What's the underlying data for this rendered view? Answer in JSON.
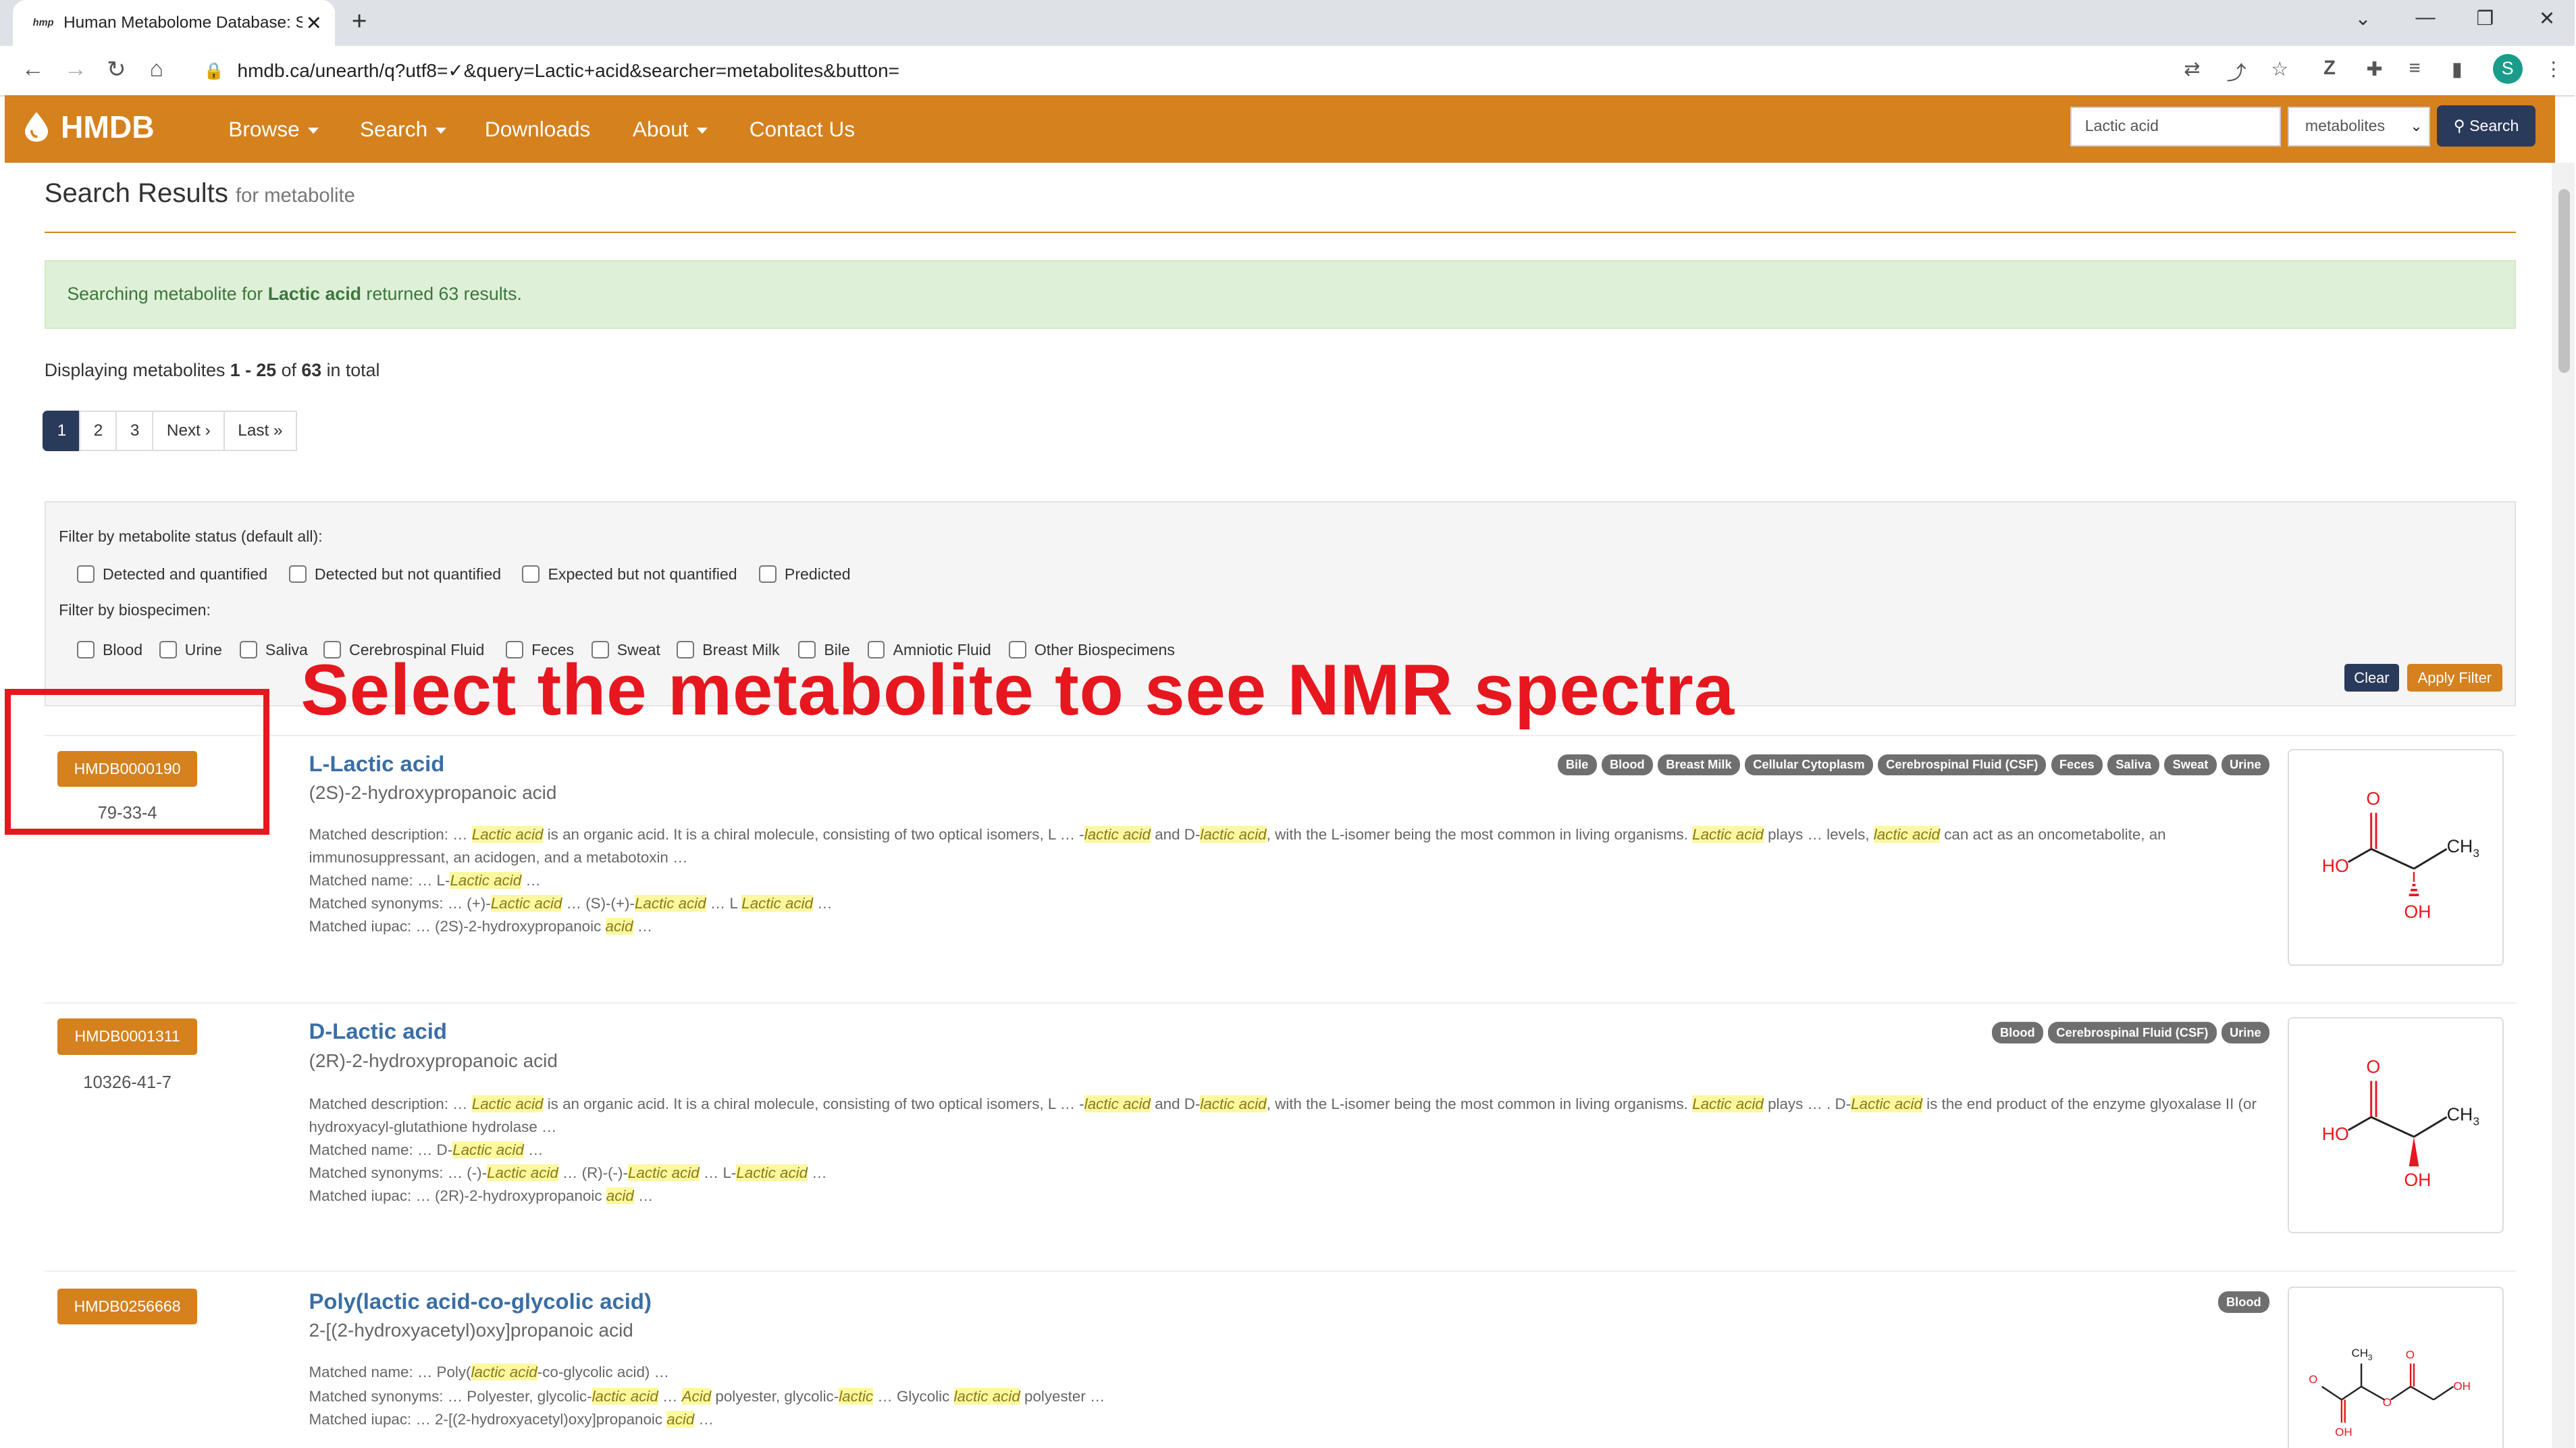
{
  "browser": {
    "tab_title": "Human Metabolome Database: S",
    "tab_favicon": "hmp",
    "url": "hmdb.ca/unearth/q?utf8=✓&query=Lactic+acid&searcher=metabolites&button=",
    "profile_initial": "S"
  },
  "navbar": {
    "logo": "HMDB",
    "menu": [
      "Browse",
      "Search",
      "Downloads",
      "About",
      "Contact Us"
    ],
    "search_value": "Lactic acid",
    "search_type": "metabolites",
    "search_button": "Search",
    "color": "#d4811e"
  },
  "page": {
    "title": "Search Results",
    "title_sub": "for metabolite",
    "alert_pre": "Searching metabolite for ",
    "alert_query": "Lactic acid",
    "alert_post": " returned 63 results.",
    "displaying_pre": "Displaying metabolites ",
    "displaying_range": "1 - 25",
    "displaying_of": " of ",
    "displaying_total": "63",
    "displaying_post": " in total",
    "pager": [
      "1",
      "2",
      "3",
      "Next ›",
      "Last »"
    ]
  },
  "filters": {
    "status_label": "Filter by metabolite status (default all):",
    "status": [
      "Detected and quantified",
      "Detected but not quantified",
      "Expected but not quantified",
      "Predicted"
    ],
    "biospecimen_label": "Filter by biospecimen:",
    "biospecimens": [
      "Blood",
      "Urine",
      "Saliva",
      "Cerebrospinal Fluid",
      "Feces",
      "Sweat",
      "Breast Milk",
      "Bile",
      "Amniotic Fluid",
      "Other Biospecimens"
    ],
    "clear": "Clear",
    "apply": "Apply Filter"
  },
  "annotation": {
    "text": "Select the metabolite to see  NMR spectra",
    "color": "#e6171e"
  },
  "results": [
    {
      "id": "HMDB0000190",
      "cas": "79-33-4",
      "name": "L-Lactic acid",
      "iupac": "(2S)-2-hydroxypropanoic acid",
      "tags": [
        "Bile",
        "Blood",
        "Breast Milk",
        "Cellular Cytoplasm",
        "Cerebrospinal Fluid (CSF)",
        "Feces",
        "Saliva",
        "Sweat",
        "Urine"
      ],
      "desc_1": "Matched description: … ",
      "desc_2": "Lactic acid",
      "desc_3": " is an organic acid. It is a chiral molecule, consisting of two optical isomers, L … -",
      "desc_4": "lactic acid",
      "desc_5": " and D-",
      "desc_6": "lactic acid",
      "desc_7": ", with the L-isomer being the most common in living organisms. ",
      "desc_8": "Lactic acid",
      "desc_9": " plays … levels, ",
      "desc_10": "lactic acid",
      "desc_11": " can act as an oncometabolite, an immunosuppressant, an acidogen, and a metabotoxin …",
      "name_1": "Matched name: … L-",
      "name_2": "Lactic acid",
      "name_3": " …",
      "syn_1": "Matched synonyms: … (+)-",
      "syn_2": "Lactic acid",
      "syn_3": " … (S)-(+)-",
      "syn_4": "Lactic acid",
      "syn_5": " … L ",
      "syn_6": "Lactic acid",
      "syn_7": " …",
      "iup_1": "Matched iupac: … (2S)-2-hydroxypropanoic ",
      "iup_2": "acid",
      "iup_3": " …",
      "s_o": "O",
      "s_ho": "HO",
      "s_ch3": "CH",
      "s_3": "3",
      "s_oh": "OH"
    },
    {
      "id": "HMDB0001311",
      "cas": "10326-41-7",
      "name": "D-Lactic acid",
      "iupac": "(2R)-2-hydroxypropanoic acid",
      "tags": [
        "Blood",
        "Cerebrospinal Fluid (CSF)",
        "Urine"
      ],
      "desc_1": "Matched description: … ",
      "desc_2": "Lactic acid",
      "desc_3": " is an organic acid. It is a chiral molecule, consisting of two optical isomers, L … -",
      "desc_4": "lactic acid",
      "desc_5": " and D-",
      "desc_6": "lactic acid",
      "desc_7": ", with the L-isomer being the most common in living organisms. ",
      "desc_8": "Lactic acid",
      "desc_9": " plays … . D-",
      "desc_10": "Lactic acid",
      "desc_11": " is the end product of the enzyme glyoxalase II (or hydroxyacyl-glutathione hydrolase …",
      "name_1": "Matched name: … D-",
      "name_2": "Lactic acid",
      "name_3": " …",
      "syn_1": "Matched synonyms: … (-)-",
      "syn_2": "Lactic acid",
      "syn_3": " … (R)-(-)-",
      "syn_4": "Lactic acid",
      "syn_5": " … L-",
      "syn_6": "Lactic acid",
      "syn_7": " …",
      "iup_1": "Matched iupac: … (2R)-2-hydroxypropanoic ",
      "iup_2": "acid",
      "iup_3": " …",
      "s_o": "O",
      "s_ho": "HO",
      "s_ch3": "CH",
      "s_3": "3",
      "s_oh": "OH"
    },
    {
      "id": "HMDB0256668",
      "name": "Poly(lactic acid-co-glycolic acid)",
      "iupac": "2-[(2-hydroxyacetyl)oxy]propanoic acid",
      "tags": [
        "Blood"
      ],
      "name_1": "Matched name: … Poly(",
      "name_2": "lactic acid",
      "name_3": "-co-glycolic acid) …",
      "syn_1": "Matched synonyms: … Polyester, glycolic-",
      "syn_2": "lactic acid",
      "syn_3": " … ",
      "syn_4": "Acid",
      "syn_5": " polyester, glycolic-",
      "syn_6": "lactic",
      "syn_7": " … Glycolic ",
      "syn_8": "lactic acid",
      "syn_9": " polyester …",
      "iup_1": "Matched iupac: … 2-[(2-hydroxyacetyl)oxy]propanoic ",
      "iup_2": "acid",
      "iup_3": " …",
      "s_ch": "CH",
      "s_3": "3",
      "s_o": "O",
      "s_oh": "OH"
    }
  ]
}
